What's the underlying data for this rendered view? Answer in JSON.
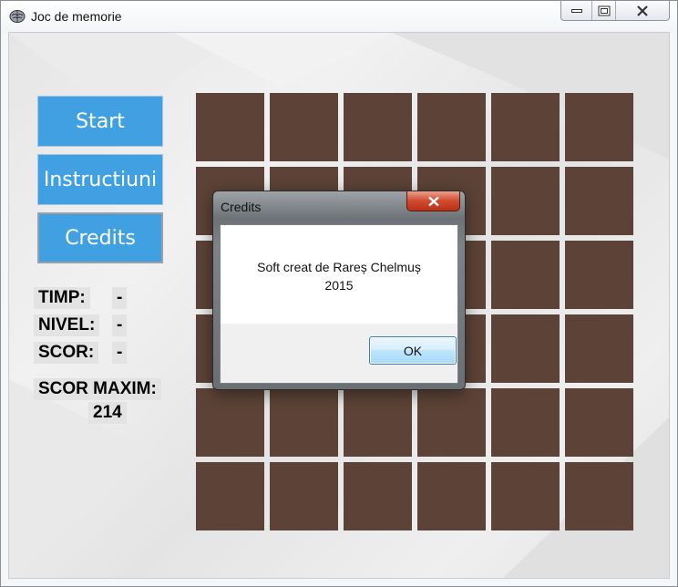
{
  "window": {
    "title": "Joc de memorie",
    "icon": "brain-icon"
  },
  "menu": {
    "start_label": "Start",
    "instructions_label": "Instructiuni",
    "credits_label": "Credits"
  },
  "stats": {
    "time_label": "TIMP:",
    "time_value": "-",
    "level_label": "NIVEL:",
    "level_value": "-",
    "score_label": "SCOR:",
    "score_value": "-",
    "max_score_label": "SCOR MAXIM:",
    "max_score_value": "214"
  },
  "board": {
    "rows": 6,
    "cols": 6,
    "tile_color": "#5d4337"
  },
  "dialog": {
    "title": "Credits",
    "message_line1": "Soft creat de Rareș Chelmuș",
    "message_line2": "2015",
    "ok_label": "OK"
  },
  "colors": {
    "button": "#40a0e2",
    "close_button": "#c73b22"
  }
}
